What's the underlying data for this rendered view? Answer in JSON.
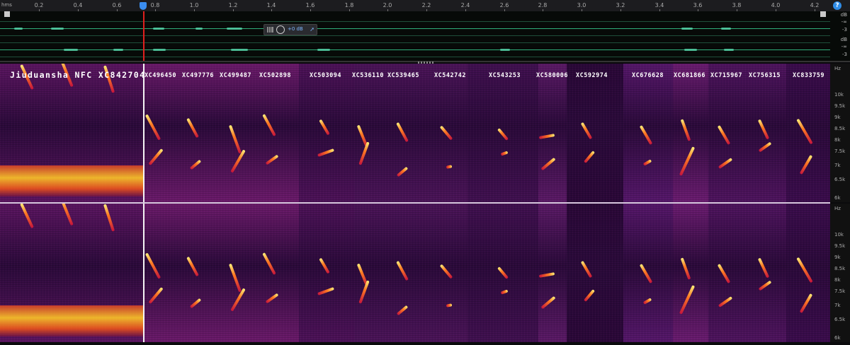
{
  "ruler": {
    "unit": "hms",
    "ticks": [
      "0.2",
      "0.4",
      "0.6",
      "0.8",
      "1.0",
      "1.2",
      "1.4",
      "1.6",
      "1.8",
      "2.0",
      "2.2",
      "2.4",
      "2.6",
      "2.8",
      "3.0",
      "3.2",
      "3.4",
      "3.6",
      "3.8",
      "4.0",
      "4.2"
    ],
    "help_label": "?"
  },
  "overview": {
    "level_label": "+0 dB",
    "db_top": [
      "dB",
      "-∞",
      "-3"
    ],
    "db_bottom": [
      "dB",
      "-∞",
      "-3"
    ]
  },
  "spectrogram": {
    "title": "Jiuduansha NFC XC842704",
    "recordings": [
      "XC496450",
      "XC497776",
      "XC499487",
      "XC502898",
      "XC503094",
      "XC536110",
      "XC539465",
      "XC542742",
      "XC543253",
      "XC580006",
      "XC592974",
      "XC676628",
      "XC681866",
      "XC715967",
      "XC756315",
      "XC833759"
    ],
    "freq_labels_top": [
      "Hz",
      "10k",
      "9.5k",
      "9k",
      "8.5k",
      "8k",
      "7.5k",
      "7k",
      "6.5k",
      "6k"
    ],
    "freq_labels_bottom": [
      "Hz",
      "10k",
      "9.5k",
      "9k",
      "8.5k",
      "8k",
      "7.5k",
      "7k",
      "6.5k",
      "6k"
    ]
  },
  "colors": {
    "spectrogram_dark": "#3a0a4a",
    "spectrogram_mid": "#7a1a6a",
    "call_hot": "#ffde60",
    "waveform": "#57d7ad",
    "playhead": "#e0201e",
    "accent": "#3a8df0"
  }
}
